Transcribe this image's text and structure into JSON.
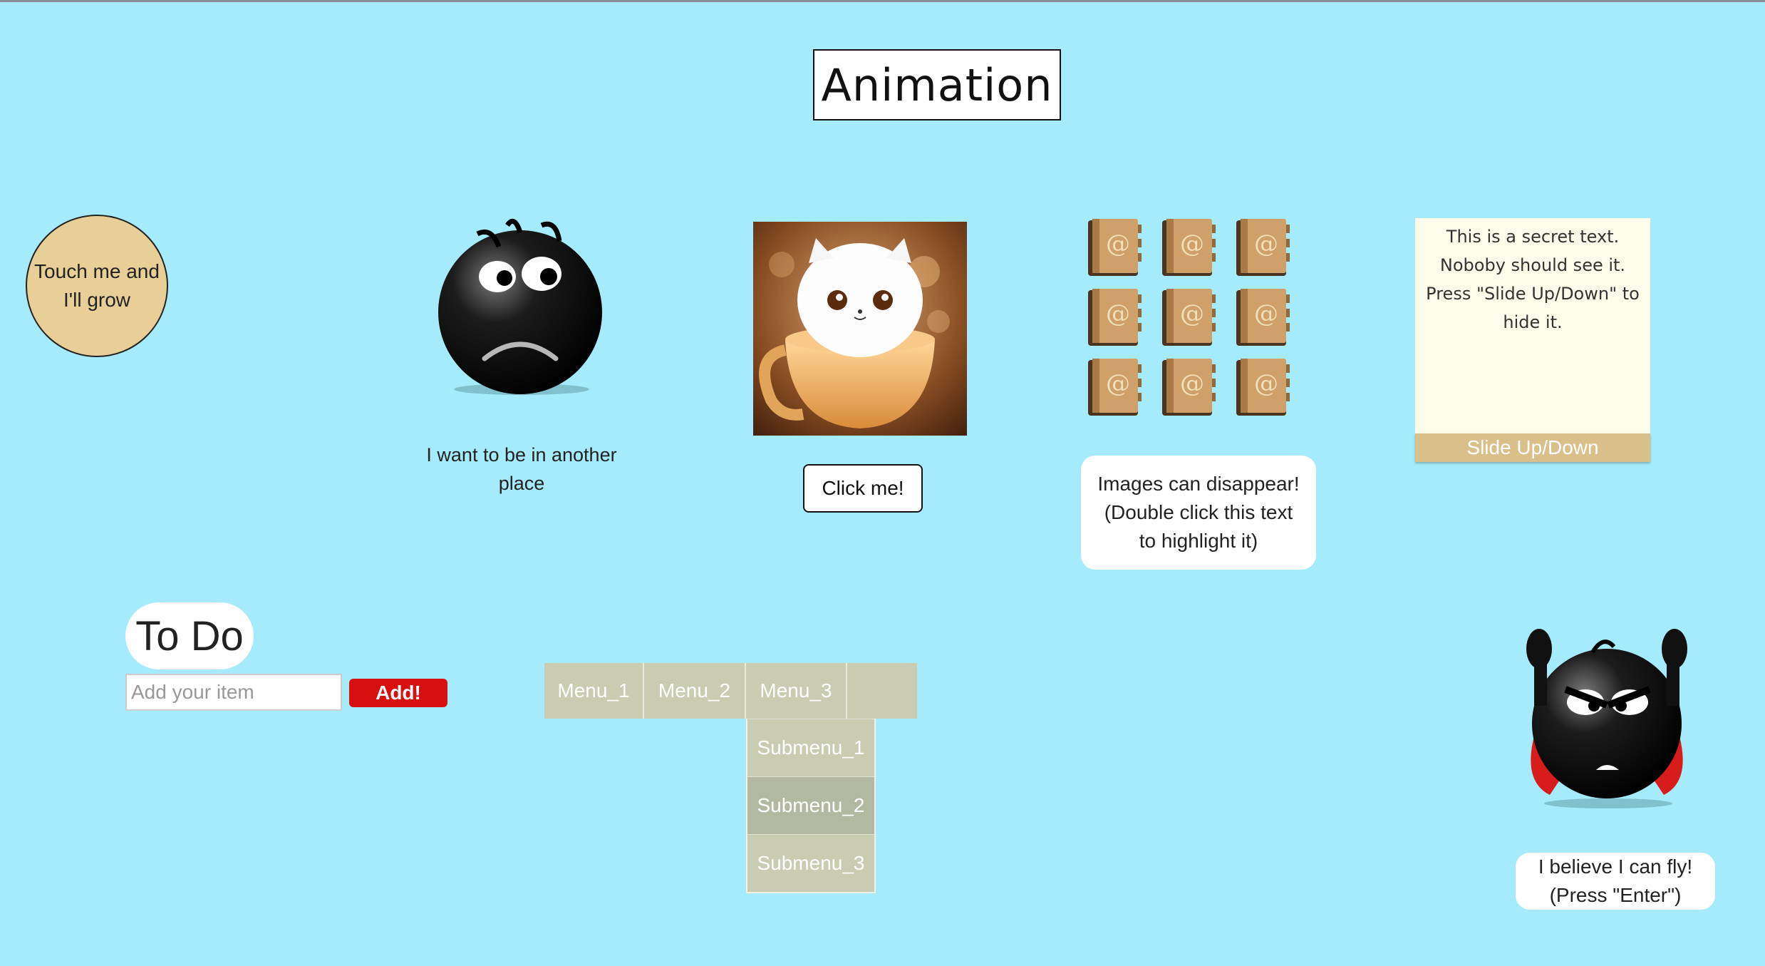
{
  "page": {
    "title": "Animation"
  },
  "grow_circle": {
    "line1": "Touch me and",
    "line2": "I'll grow"
  },
  "worried_emoji": {
    "caption_line1": "I want to be in another",
    "caption_line2": "place"
  },
  "cat_image": {
    "button_label": "Click me!"
  },
  "address_books": {
    "icon": "address-book-icon",
    "count": 9,
    "note_line1": "Images can disappear!",
    "note_line2": "(Double click this text",
    "note_line3": "to highlight it)"
  },
  "secret_panel": {
    "line1": "This is a secret text.",
    "line2": "Noboby should see it.",
    "line3": "Press \"Slide Up/Down\" to",
    "line4": "hide it.",
    "button_label": "Slide Up/Down"
  },
  "todo": {
    "title": "To Do",
    "input_placeholder": "Add your item",
    "input_value": "",
    "add_label": "Add!"
  },
  "menu": {
    "items": [
      "Menu_1",
      "Menu_2",
      "Menu_3"
    ],
    "submenu": [
      "Submenu_1",
      "Submenu_2",
      "Submenu_3"
    ],
    "active_submenu": "Submenu_2"
  },
  "flying_emoji": {
    "caption_line1": "I believe I can fly!",
    "caption_line2": "(Press \"Enter\")"
  },
  "colors": {
    "background": "#a6ebfb",
    "circle": "#e8cf97",
    "menu": "#c9ccb0",
    "add_button": "#d70f0f",
    "slide_button": "#d9c08a",
    "secret_panel": "#fdfcea"
  }
}
